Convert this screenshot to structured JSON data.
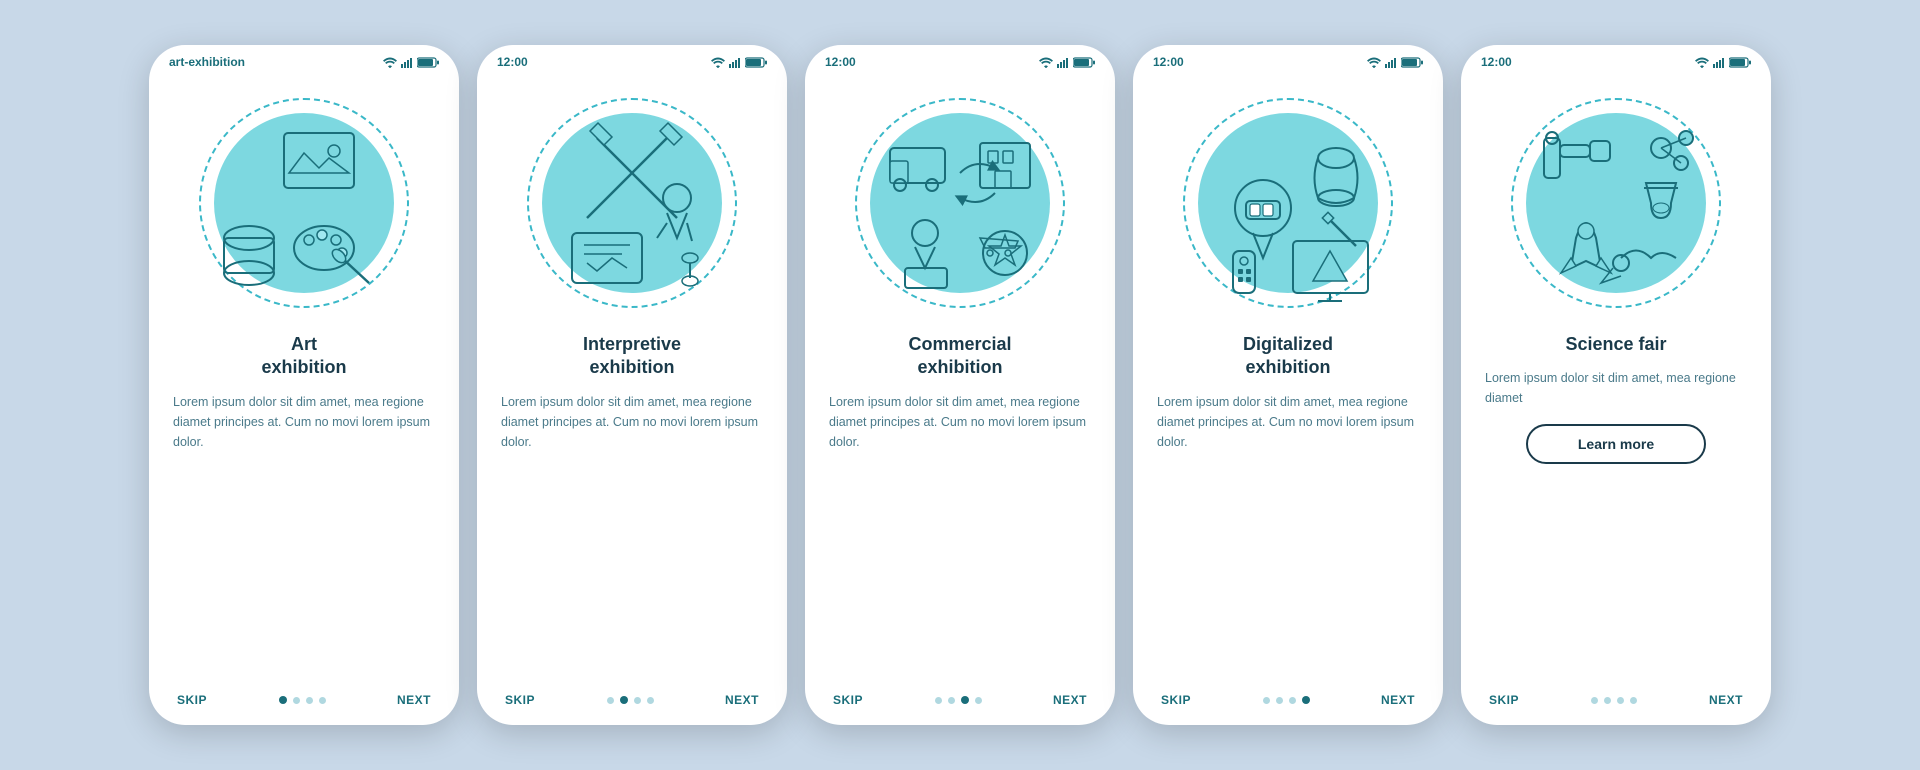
{
  "bg_color": "#c8d8e8",
  "cards": [
    {
      "id": "art-exhibition",
      "title": "Art\nexhibition",
      "desc": "Lorem ipsum dolor sit dim amet, mea regione diamet principes at. Cum no movi lorem ipsum dolor.",
      "active_dot": 0,
      "skip_label": "SKIP",
      "next_label": "NEXT",
      "has_learn_more": false,
      "learn_more_label": ""
    },
    {
      "id": "interpretive-exhibition",
      "title": "Interpretive\nexhibition",
      "desc": "Lorem ipsum dolor sit dim amet, mea regione diamet principes at. Cum no movi lorem ipsum dolor.",
      "active_dot": 1,
      "skip_label": "SKIP",
      "next_label": "NEXT",
      "has_learn_more": false,
      "learn_more_label": ""
    },
    {
      "id": "commercial-exhibition",
      "title": "Commercial\nexhibition",
      "desc": "Lorem ipsum dolor sit dim amet, mea regione diamet principes at. Cum no movi lorem ipsum dolor.",
      "active_dot": 2,
      "skip_label": "SKIP",
      "next_label": "NEXT",
      "has_learn_more": false,
      "learn_more_label": ""
    },
    {
      "id": "digitalized-exhibition",
      "title": "Digitalized\nexhibition",
      "desc": "Lorem ipsum dolor sit dim amet, mea regione diamet principes at. Cum no movi lorem ipsum dolor.",
      "active_dot": 3,
      "skip_label": "SKIP",
      "next_label": "NEXT",
      "has_learn_more": false,
      "learn_more_label": ""
    },
    {
      "id": "science-fair",
      "title": "Science fair",
      "desc": "Lorem ipsum dolor sit dim amet, mea regione diamet",
      "active_dot": 4,
      "skip_label": "SKIP",
      "next_label": "NEXT",
      "has_learn_more": true,
      "learn_more_label": "Learn more"
    }
  ]
}
